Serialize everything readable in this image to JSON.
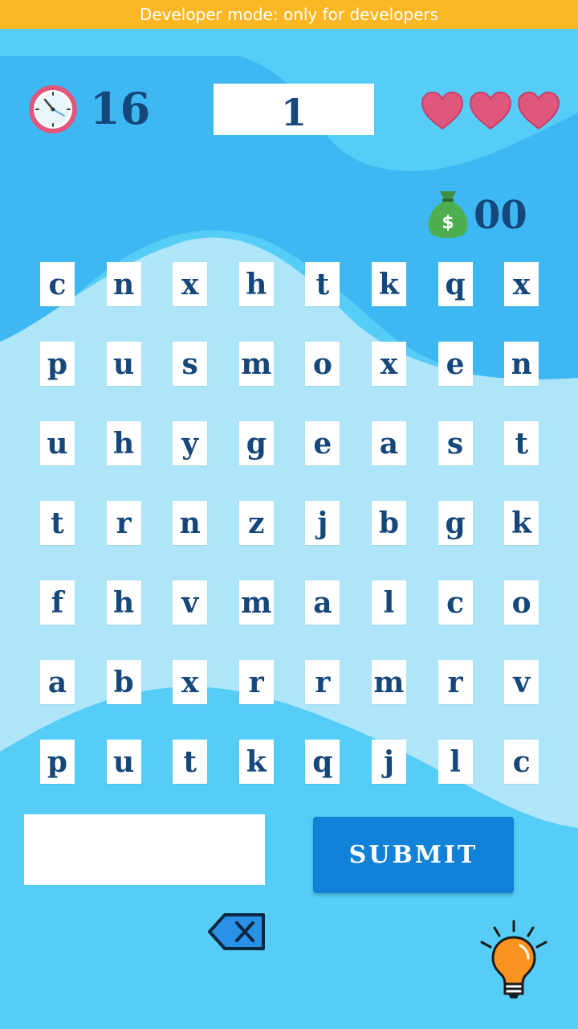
{
  "banner": {
    "text": "Developer mode: only for developers"
  },
  "status": {
    "timer": "16",
    "level": "1",
    "lives": 3,
    "money": "00"
  },
  "grid": {
    "rows": [
      [
        "c",
        "n",
        "x",
        "h",
        "t",
        "k",
        "q",
        "x"
      ],
      [
        "p",
        "u",
        "s",
        "m",
        "o",
        "x",
        "e",
        "n"
      ],
      [
        "u",
        "h",
        "y",
        "g",
        "e",
        "a",
        "s",
        "t"
      ],
      [
        "t",
        "r",
        "n",
        "z",
        "j",
        "b",
        "g",
        "k"
      ],
      [
        "f",
        "h",
        "v",
        "m",
        "a",
        "l",
        "c",
        "o"
      ],
      [
        "a",
        "b",
        "x",
        "r",
        "r",
        "m",
        "r",
        "v"
      ],
      [
        "p",
        "u",
        "t",
        "k",
        "q",
        "j",
        "l",
        "c"
      ]
    ]
  },
  "answer": {
    "value": "",
    "placeholder": ""
  },
  "controls": {
    "submit_label": "SUBMIT"
  },
  "icons": {
    "clock": "clock-icon",
    "heart": "heart-icon",
    "money": "money-bag-icon",
    "backspace": "backspace-icon",
    "hint": "lightbulb-icon"
  },
  "colors": {
    "banner": "#fbb724",
    "text": "#15477a",
    "submit": "#1281d8",
    "heart": "#e0577e",
    "money": "#4cae4f",
    "bulb": "#f7931e"
  }
}
